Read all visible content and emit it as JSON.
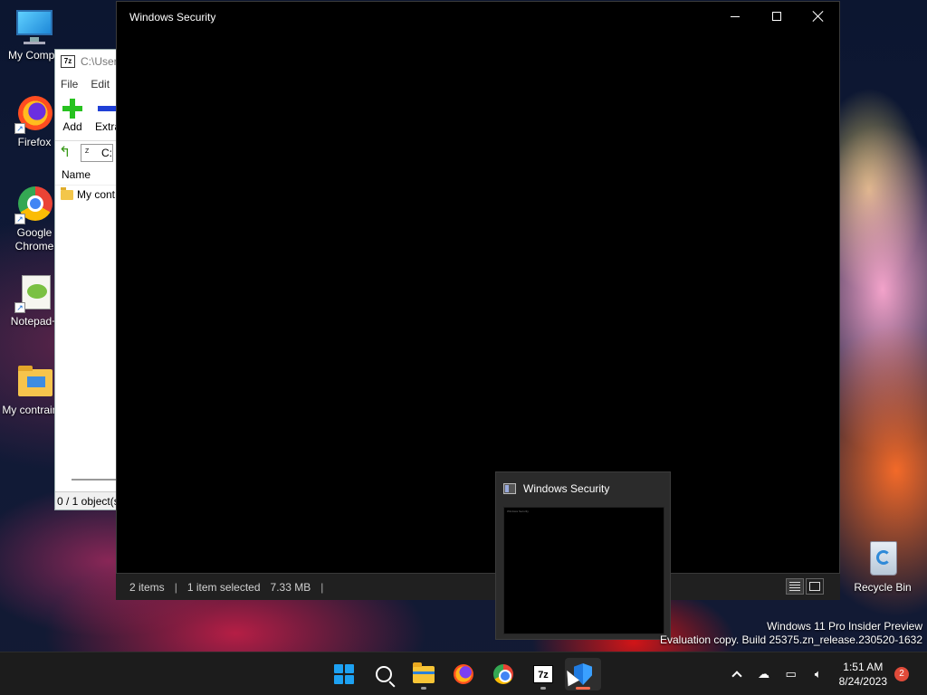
{
  "desktop": {
    "icons": [
      {
        "label": "My Compu",
        "icon": "computer-monitor-icon"
      },
      {
        "label": "Firefox",
        "icon": "firefox-icon"
      },
      {
        "label": "Google Chrome",
        "icon": "chrome-icon"
      },
      {
        "label": "Notepad+",
        "icon": "notepad-plus-plus-icon"
      },
      {
        "label": "My contraindi",
        "icon": "folder-icon"
      }
    ],
    "recycle_bin": {
      "label": "Recycle Bin",
      "icon": "recycle-bin-icon"
    }
  },
  "zip_window": {
    "title_path": "C:\\User",
    "menu": [
      "File",
      "Edit"
    ],
    "tools": [
      {
        "label": "Add",
        "icon": "plus-icon"
      },
      {
        "label": "Extra",
        "icon": "minus-icon"
      }
    ],
    "address_value": "C:",
    "column_header": "Name",
    "rows": [
      "My cont"
    ],
    "status": "0 / 1 object(s"
  },
  "security_window": {
    "title": "Windows Security",
    "status_items": "2 items",
    "status_selection": "1 item selected",
    "status_size": "7.33 MB"
  },
  "thumbnail": {
    "title": "Windows Security",
    "mini_title": "Windows Security"
  },
  "watermark": {
    "line1": "Windows 11 Pro Insider Preview",
    "line2": "Evaluation copy. Build 25375.zn_release.230520-1632"
  },
  "taskbar": {
    "apps": [
      {
        "name": "Start",
        "icon": "windows-logo-icon"
      },
      {
        "name": "Search",
        "icon": "search-icon"
      },
      {
        "name": "File Explorer",
        "icon": "folder-icon"
      },
      {
        "name": "Firefox",
        "icon": "firefox-icon"
      },
      {
        "name": "Google Chrome",
        "icon": "chrome-icon"
      },
      {
        "name": "7-Zip",
        "icon": "7zip-icon",
        "glyph": "7z"
      },
      {
        "name": "Windows Security",
        "icon": "shield-icon"
      }
    ],
    "clock_time": "1:51 AM",
    "clock_date": "8/24/2023",
    "notification_count": "2"
  },
  "colors": {
    "accent": "#1da1f2",
    "active_indicator": "#ff6b4d",
    "taskbar_bg": "#1c1c1c"
  }
}
